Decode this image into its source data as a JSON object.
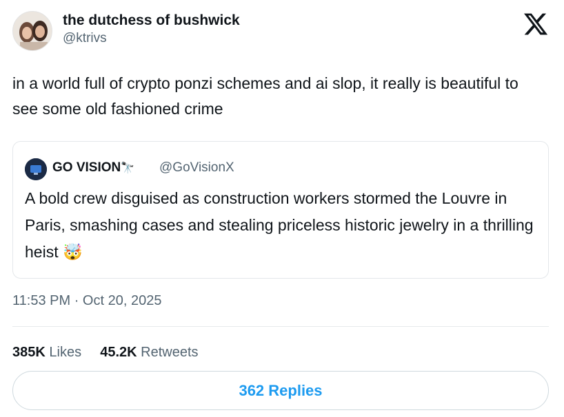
{
  "author": {
    "name": "the dutchess of bushwick",
    "handle": "@ktrivs"
  },
  "tweet": {
    "text": "in a world full of crypto ponzi schemes and ai slop, it really is beautiful to see some old fashioned crime"
  },
  "quote": {
    "name": "GO VISION",
    "name_emoji": "🔭",
    "handle": "@GoVisionX",
    "text": "A bold crew disguised as construction workers stormed the Louvre in Paris, smashing cases and stealing priceless historic jewelry in a thrilling heist",
    "emoji": "🤯"
  },
  "meta": {
    "time": "11:53 PM",
    "separator": "·",
    "date": "Oct 20, 2025"
  },
  "stats": {
    "likes_count": "385K",
    "likes_label": "Likes",
    "retweets_count": "45.2K",
    "retweets_label": "Retweets"
  },
  "replies_button": "362 Replies",
  "icons": {
    "platform_logo": "x-logo-icon",
    "time_separator": "dot"
  },
  "colors": {
    "link_blue": "#1d9bf0",
    "secondary_text": "#536471",
    "primary_text": "#0f1419"
  }
}
